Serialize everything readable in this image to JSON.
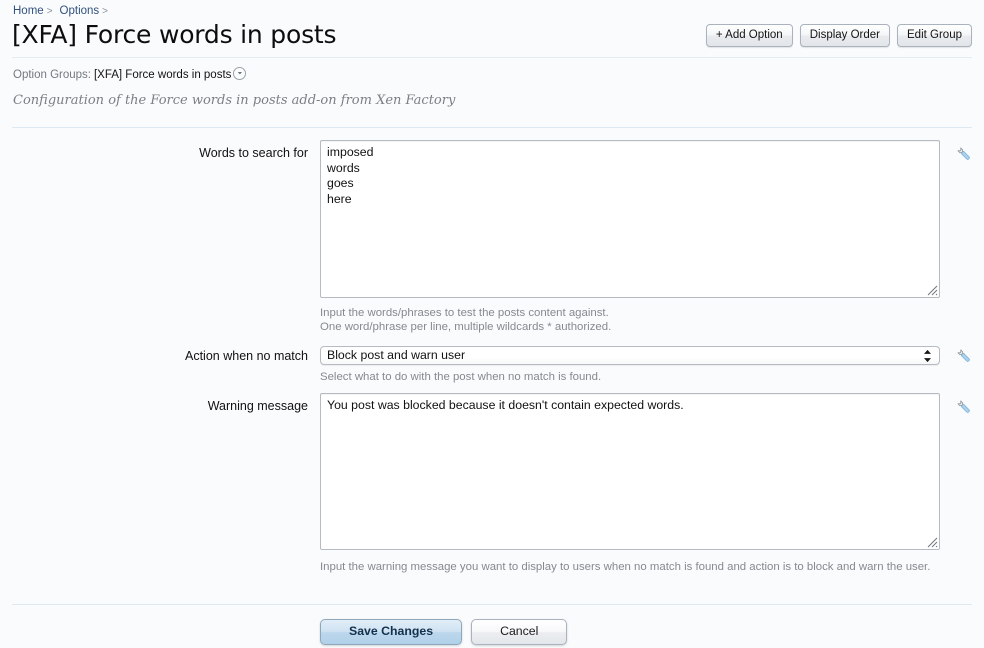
{
  "breadcrumb": {
    "items": [
      {
        "label": "Home",
        "separator": ">"
      },
      {
        "label": "Options",
        "separator": ">"
      }
    ]
  },
  "header": {
    "title": "[XFA] Force words in posts",
    "buttons": [
      {
        "id": "add-option",
        "label": "+ Add Option"
      },
      {
        "id": "display-order",
        "label": "Display Order"
      },
      {
        "id": "edit-group",
        "label": "Edit Group"
      }
    ]
  },
  "option_groups": {
    "label": "Option Groups:",
    "value": "[XFA] Force words in posts",
    "chevron_icon": "chevron-down-circle-icon"
  },
  "subtitle": "Configuration of the Force words in posts add-on from Xen Factory",
  "form": {
    "rows": [
      {
        "id": "words-to-search-for",
        "label": "Words to search for",
        "type": "textarea",
        "value": "imposed\nwords\ngoes\nhere",
        "hints": [
          "Input the words/phrases to test the posts content against.",
          "One word/phrase per line, multiple wildcards * authorized."
        ],
        "edit_icon": "wrench-icon"
      },
      {
        "id": "action-when-no-match",
        "label": "Action when no match",
        "type": "select",
        "value": "Block post and warn user",
        "options": [
          "Block post and warn user"
        ],
        "hints": [
          "Select what to do with the post when no match is found."
        ],
        "edit_icon": "wrench-icon"
      },
      {
        "id": "warning-message",
        "label": "Warning message",
        "type": "textarea",
        "value": "You post was blocked because it doesn't contain expected words.",
        "hints": [
          "Input the warning message you want to display to users when no match is found and action is to block and warn the user."
        ],
        "edit_icon": "wrench-icon"
      }
    ]
  },
  "footer": {
    "save_label": "Save Changes",
    "cancel_label": "Cancel"
  },
  "colors": {
    "page_background": "#fafbfd",
    "breadcrumb_link": "#31517f",
    "divider": "#dce8f2",
    "hint_text": "#85898f",
    "primary_button": "#bcd7ec",
    "wrench_icon": "#9cc9e8"
  }
}
